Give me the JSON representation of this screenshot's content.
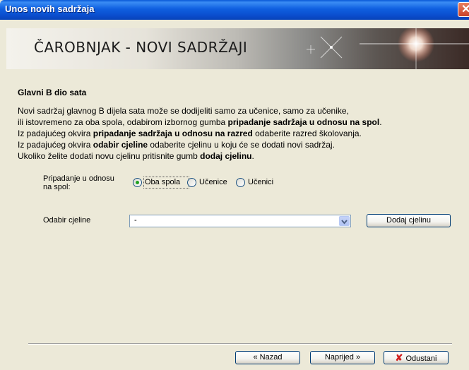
{
  "window": {
    "title": "Unos novih sadržaja"
  },
  "banner": {
    "title": "ČAROBNJAK - NOVI SADRŽAJI"
  },
  "section": {
    "heading": "Glavni B dio sata",
    "line1": "Novi sadržaj glavnog B dijela sata može se dodijeliti samo za učenice, samo za učenike,",
    "line2_pre": "ili istovremeno za oba spola, odabirom izbornog gumba ",
    "line2_bold": "pripadanje sadržaja u odnosu na spol",
    "line2_post": ".",
    "line3_pre": "Iz padajućeg okvira ",
    "line3_bold": "pripadanje sadržaja u odnosu na razred",
    "line3_post": " odaberite razred školovanja.",
    "line4_pre": "Iz padajućeg okvira ",
    "line4_bold": "odabir cjeline",
    "line4_post": " odaberite cjelinu u koju će se dodati novi sadržaj.",
    "line5_pre": "Ukoliko želite dodati novu cjelinu pritisnite gumb ",
    "line5_bold": "dodaj cjelinu",
    "line5_post": "."
  },
  "gender": {
    "label_line1": "Pripadanje u odnosu",
    "label_line2": "na spol:",
    "options": [
      "Oba spola",
      "Učenice",
      "Učenici"
    ],
    "selected": "Oba spola"
  },
  "unit": {
    "label": "Odabir cjeline",
    "value": "-",
    "add_button": "Dodaj cjelinu"
  },
  "footer": {
    "back_button": "« Nazad",
    "next_button": "Naprijed »",
    "cancel_button": "Odustani"
  },
  "colors": {
    "titlebar": "#0a4ccc",
    "window_bg": "#ece9d8",
    "radio_selected": "#21a121",
    "cancel_icon": "#d12020"
  }
}
